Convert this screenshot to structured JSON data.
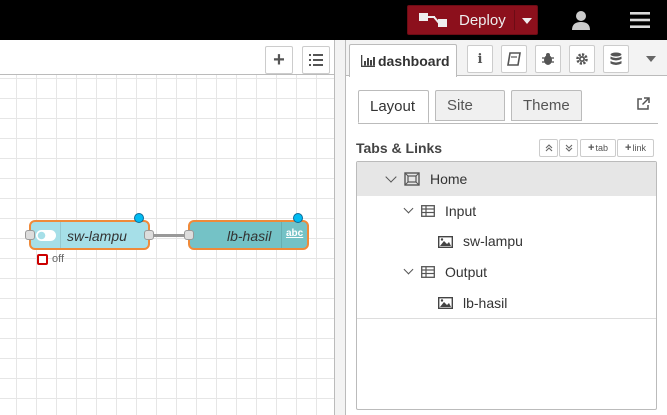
{
  "header": {
    "deploy_label": "Deploy",
    "accent": "#8c101c"
  },
  "workspace": {
    "nodes": [
      {
        "label": "sw-lampu",
        "status": "off",
        "color": "#a6dfe8"
      },
      {
        "label": "lb-hasil",
        "badge": "abc",
        "color": "#74c2c6"
      }
    ]
  },
  "sidebar": {
    "active_panel": "dashboard",
    "tabs": [
      "Layout",
      "Site",
      "Theme"
    ],
    "section_title": "Tabs & Links",
    "buttons": {
      "tab": "tab",
      "link": "link"
    },
    "tree": {
      "home": "Home",
      "groups": [
        {
          "name": "Input",
          "widgets": [
            "sw-lampu"
          ]
        },
        {
          "name": "Output",
          "widgets": [
            "lb-hasil"
          ]
        }
      ]
    }
  }
}
